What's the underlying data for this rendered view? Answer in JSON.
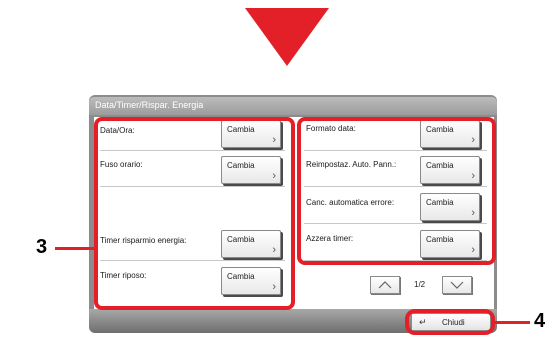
{
  "window": {
    "title": "Data/Timer/Rispar. Energia"
  },
  "settings": {
    "left": [
      {
        "label": "Data/Ora:",
        "button": "Cambia"
      },
      {
        "label": "Fuso orario:",
        "button": "Cambia"
      },
      {
        "label": "Timer risparmio energia:",
        "button": "Cambia"
      },
      {
        "label": "Timer riposo:",
        "button": "Cambia"
      }
    ],
    "right": [
      {
        "label": "Formato data:",
        "button": "Cambia"
      },
      {
        "label": "Reimpostaz. Auto. Pann.:",
        "button": "Cambia"
      },
      {
        "label": "Canc. automatica errore:",
        "button": "Cambia"
      },
      {
        "label": "Azzera timer:",
        "button": "Cambia"
      }
    ]
  },
  "pagination": {
    "page": "1/2"
  },
  "footer": {
    "close_label": "Chiudi"
  },
  "callouts": {
    "left": "3",
    "right": "4"
  },
  "colors": {
    "highlight": "#e32027",
    "panel": "#8c8c8c"
  },
  "icons": [
    "arrow-down-icon",
    "chevron-right-icon",
    "chevron-up-icon",
    "chevron-down-icon",
    "enter-icon"
  ]
}
